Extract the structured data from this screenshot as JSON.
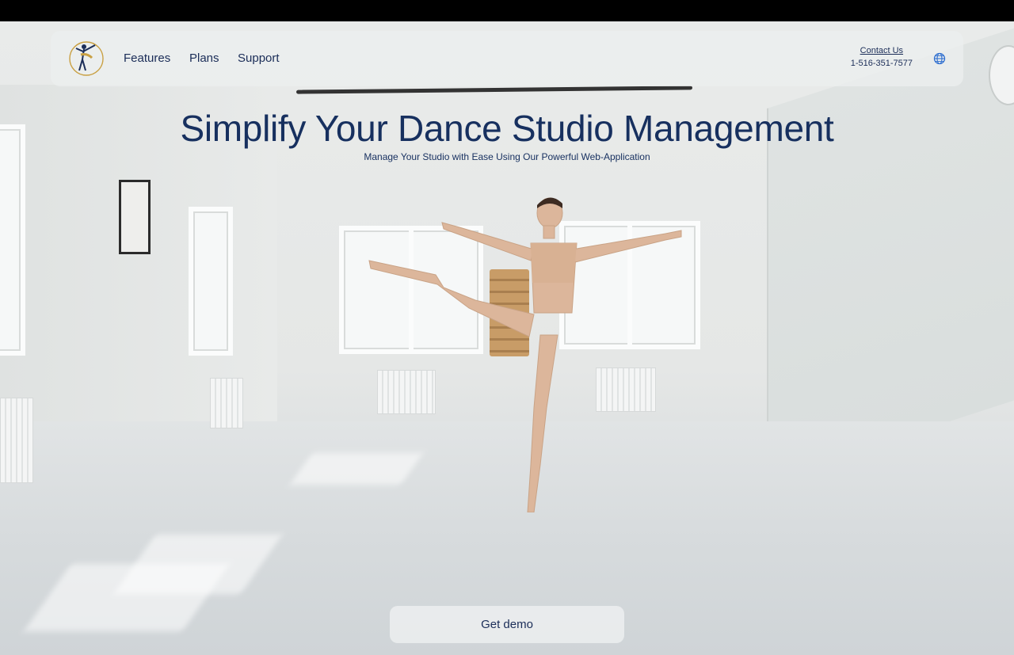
{
  "nav": {
    "links": [
      "Features",
      "Plans",
      "Support"
    ],
    "contact_label": "Contact Us",
    "phone": "1-516-351-7577"
  },
  "hero": {
    "title": "Simplify Your Dance Studio Management",
    "subtitle": "Manage Your Studio with Ease Using Our Powerful Web-Application",
    "cta_label": "Get demo"
  },
  "colors": {
    "text": "#17305f",
    "logo_gold": "#c9a043",
    "logo_navy": "#1b2d58",
    "accent": "#2f6fd0"
  },
  "icons": [
    "dancer-logo-icon",
    "globe-icon"
  ]
}
